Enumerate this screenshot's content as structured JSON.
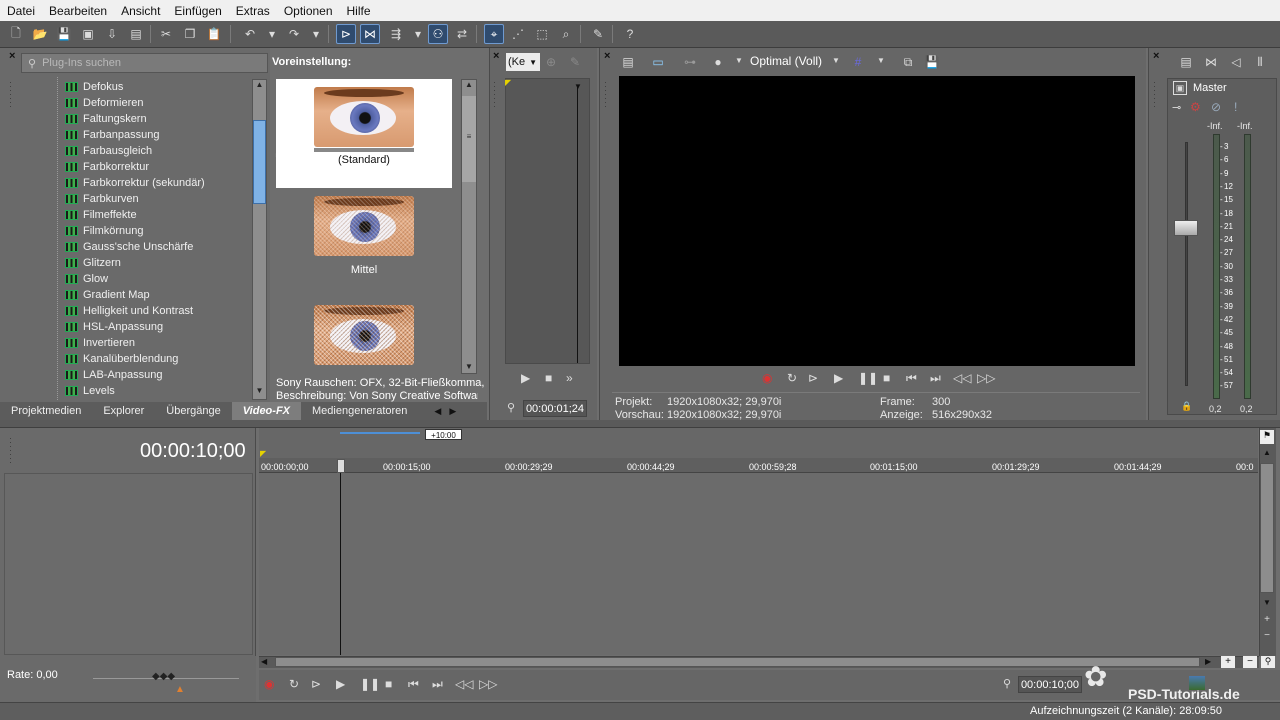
{
  "menu": [
    "Datei",
    "Bearbeiten",
    "Ansicht",
    "Einfügen",
    "Extras",
    "Optionen",
    "Hilfe"
  ],
  "plugins": {
    "search_placeholder": "Plug-Ins suchen",
    "items": [
      "Defokus",
      "Deformieren",
      "Faltungskern",
      "Farbanpassung",
      "Farbausgleich",
      "Farbkorrektur",
      "Farbkorrektur (sekundär)",
      "Farbkurven",
      "Filmeffekte",
      "Filmkörnung",
      "Gauss'sche Unschärfe",
      "Glitzern",
      "Glow",
      "Gradient Map",
      "Helligkeit und Kontrast",
      "HSL-Anpassung",
      "Invertieren",
      "Kanalüberblendung",
      "LAB-Anpassung",
      "Levels"
    ]
  },
  "tabs": [
    "Projektmedien",
    "Explorer",
    "Übergänge",
    "Video-FX",
    "Mediengeneratoren"
  ],
  "presets": {
    "heading": "Voreinstellung:",
    "items": [
      "(Standard)",
      "Mittel",
      ""
    ],
    "description_line1": "Sony Rauschen: OFX, 32-Bit-Fließkomma,",
    "description_line2": "Beschreibung: Von Sony Creative Softwar"
  },
  "trimmer": {
    "dropdown": "(Ke",
    "timecode": "00:00:01;24"
  },
  "preview": {
    "quality": "Optimal (Voll)",
    "projekt_label": "Projekt:",
    "projekt_value": "1920x1080x32; 29,970i",
    "vorschau_label": "Vorschau:",
    "vorschau_value": "1920x1080x32; 29,970i",
    "frame_label": "Frame:",
    "frame_value": "300",
    "anzeige_label": "Anzeige:",
    "anzeige_value": "516x290x32"
  },
  "mixer": {
    "title": "Master",
    "peak_left": "-Inf.",
    "peak_right": "-Inf.",
    "scale": [
      "3",
      "6",
      "9",
      "12",
      "15",
      "18",
      "21",
      "24",
      "27",
      "30",
      "33",
      "36",
      "39",
      "42",
      "45",
      "48",
      "51",
      "54",
      "57"
    ],
    "bottom_left": "0,2",
    "bottom_right": "0,2"
  },
  "timeline": {
    "timecode": "00:00:10;00",
    "loop_label": "+10:00",
    "ruler": [
      "00:00:00;00",
      "00:00:15;00",
      "00:00:29;29",
      "00:00:44;29",
      "00:00:59;28",
      "00:01:15;00",
      "00:01:29;29",
      "00:01:44;29",
      "00:0"
    ],
    "rate": "Rate: 0,00",
    "bottom_timecode": "00:00:10;00",
    "status": "Aufzeichnungszeit (2 Kanäle): 28:09:50",
    "watermark": "PSD-Tutorials.de"
  }
}
